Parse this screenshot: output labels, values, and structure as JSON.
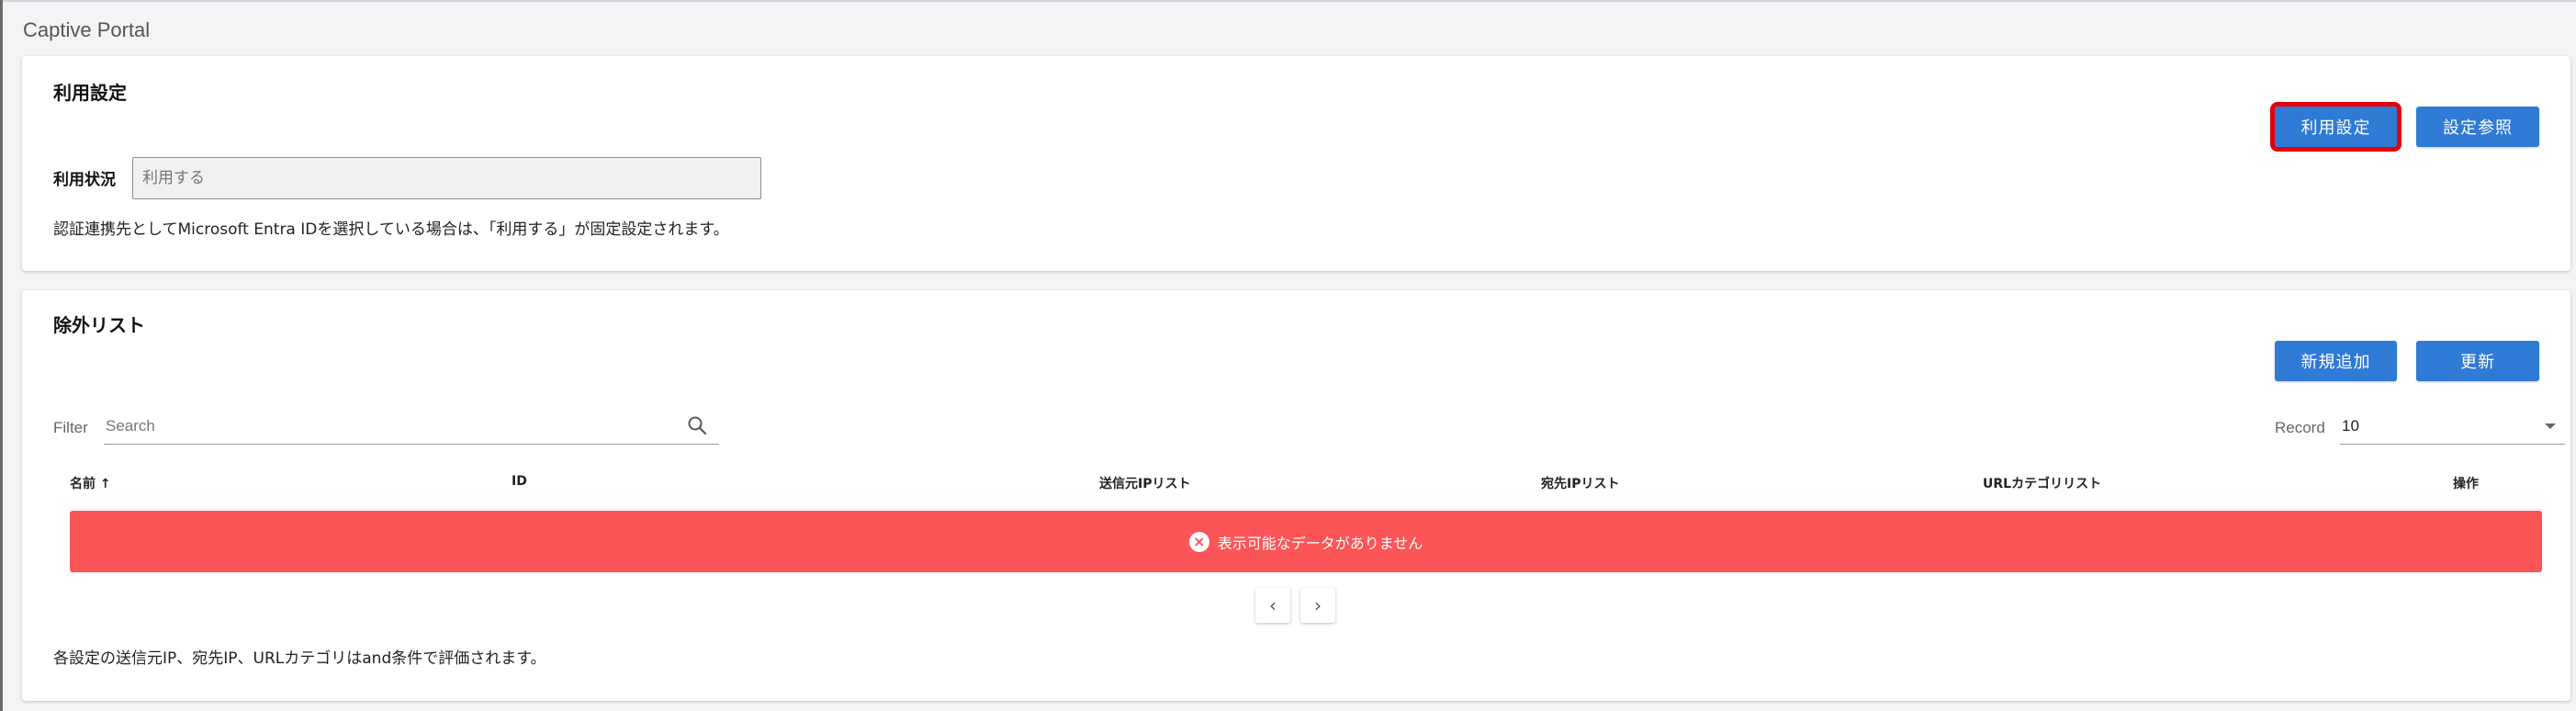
{
  "page": {
    "title": "Captive Portal"
  },
  "usage_settings": {
    "title": "利用設定",
    "buttons": {
      "usage_settings": "利用設定",
      "view_settings": "設定参照"
    },
    "status_label": "利用状況",
    "status_placeholder": "利用する",
    "note": "認証連携先としてMicrosoft Entra IDを選択している場合は、「利用する」が固定設定されます。"
  },
  "exclusion_list": {
    "title": "除外リスト",
    "buttons": {
      "add_new": "新規追加",
      "refresh": "更新"
    },
    "filter_label": "Filter",
    "search_placeholder": "Search",
    "record_label": "Record",
    "record_value": "10",
    "columns": {
      "name": "名前 ↑",
      "id": "ID",
      "source_ip_list": "送信元IPリスト",
      "dest_ip_list": "宛先IPリスト",
      "url_category_list": "URLカテゴリリスト",
      "actions": "操作"
    },
    "empty_message": "表示可能なデータがありません",
    "pagination": {
      "prev": "‹",
      "next": "›"
    },
    "note": "各設定の送信元IP、宛先IP、URLカテゴリはand条件で評価されます。"
  },
  "colors": {
    "primary_button": "#2f7ad4",
    "highlight_outline": "#e3000b",
    "error_banner": "#fb5557"
  },
  "icons": [
    "search-icon",
    "chevron-left-icon",
    "chevron-right-icon",
    "error-circle-icon",
    "dropdown-caret-icon"
  ]
}
